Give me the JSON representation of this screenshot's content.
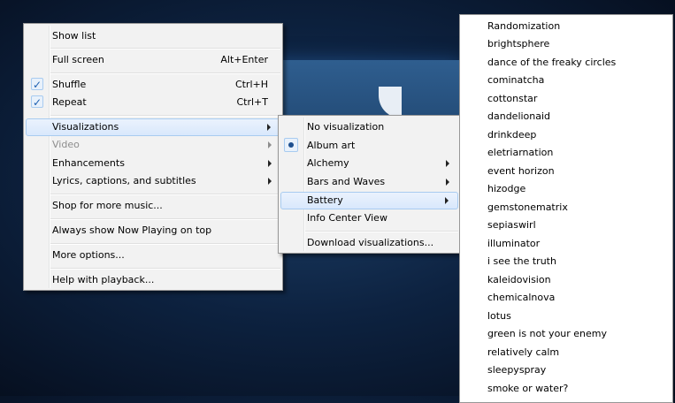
{
  "main_menu": {
    "items": [
      {
        "label": "Show list"
      },
      {
        "label": "Full screen",
        "accel": "Alt+Enter"
      },
      {
        "label": "Shuffle",
        "accel": "Ctrl+H",
        "checked": true
      },
      {
        "label": "Repeat",
        "accel": "Ctrl+T",
        "checked": true
      },
      {
        "label": "Visualizations",
        "submenu": true,
        "highlighted": true
      },
      {
        "label": "Video",
        "submenu": true,
        "disabled": true
      },
      {
        "label": "Enhancements",
        "submenu": true
      },
      {
        "label": "Lyrics, captions, and subtitles",
        "submenu": true
      },
      {
        "label": "Shop for more music..."
      },
      {
        "label": "Always show Now Playing on top"
      },
      {
        "label": "More options..."
      },
      {
        "label": "Help with playback..."
      }
    ]
  },
  "visualizations_menu": {
    "items": [
      {
        "label": "No visualization"
      },
      {
        "label": "Album art",
        "selected": true
      },
      {
        "label": "Alchemy",
        "submenu": true
      },
      {
        "label": "Bars and Waves",
        "submenu": true
      },
      {
        "label": "Battery",
        "submenu": true,
        "highlighted": true
      },
      {
        "label": "Info Center View"
      },
      {
        "label": "Download visualizations..."
      }
    ]
  },
  "battery_menu": {
    "items": [
      "Randomization",
      "brightsphere",
      "dance of the freaky circles",
      "cominatcha",
      "cottonstar",
      "dandelionaid",
      "drinkdeep",
      "eletriarnation",
      "event horizon",
      "hizodge",
      "gemstonematrix",
      "sepiaswirl",
      "illuminator",
      "i see the truth",
      "kaleidovision",
      "chemicalnova",
      "lotus",
      "green is not your enemy",
      "relatively calm",
      "sleepyspray",
      "smoke or water?"
    ]
  }
}
